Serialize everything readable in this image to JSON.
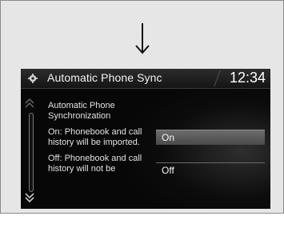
{
  "header": {
    "title": "Automatic Phone Sync",
    "time": "12:34",
    "icon": "gear-icon"
  },
  "description": {
    "heading": "Automatic Phone Synchronization",
    "on_text": "On: Phonebook and call history will be imported.",
    "off_text": "Off: Phonebook and call history will not be"
  },
  "options": [
    {
      "label": "On",
      "selected": true
    },
    {
      "label": "Off",
      "selected": false
    }
  ],
  "colors": {
    "screen_background": "#070707",
    "selected_option": "#5a5a5a",
    "frame_background": "#e6e6e6"
  }
}
